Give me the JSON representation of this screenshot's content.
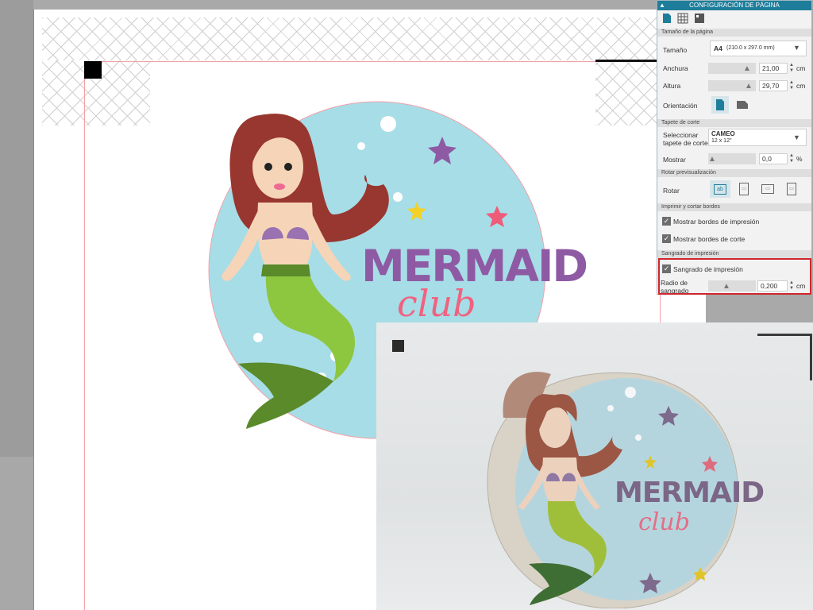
{
  "panel": {
    "title": "CONFIGURACIÓN DE PÁGINA",
    "collapse_icon": "caret-up",
    "tabs": [
      "page-icon",
      "grid-icon",
      "layer-icon"
    ],
    "page_size": {
      "section": "Tamaño de la página",
      "size_label": "Tamaño",
      "size_value": "A4",
      "size_detail": "(210.0 x 297.0 mm)",
      "width_label": "Anchura",
      "width_value": "21,00",
      "height_label": "Altura",
      "height_value": "29,70",
      "unit": "cm",
      "orientation_label": "Orientación"
    },
    "cutting_mat": {
      "section": "Tapete de corte",
      "select_label_1": "Seleccionar",
      "select_label_2": "tapete de corte",
      "mat_name": "CAMEO",
      "mat_size": "12 x 12\"",
      "show_label": "Mostrar",
      "show_value": "0,0",
      "show_unit": "%"
    },
    "rotate_preview": {
      "section": "Rotar previsualización",
      "rotate_label": "Rotar",
      "rotate_glyph": "ab"
    },
    "print_cut_borders": {
      "section": "Imprimir y cortar bordes",
      "show_print_borders": "Mostrar bordes de impresión",
      "show_cut_borders": "Mostrar bordes de corte"
    },
    "print_bleed": {
      "section": "Sangrado de impresión",
      "bleed_checkbox": "Sangrado de impresión",
      "radius_label_1": "Radio de",
      "radius_label_2": "sangrado",
      "radius_value": "0,200",
      "unit": "cm"
    }
  },
  "design": {
    "title_word": "MERMAID",
    "subtitle_word": "club"
  },
  "colors": {
    "panel_header": "#1e7d9a",
    "accent": "#1e7d9a",
    "highlight": "#d0262c",
    "circle": "#a7dde7",
    "title_purple": "#8e5aa3",
    "club_pink": "#f0627f",
    "hair": "#98372f",
    "skin": "#f6d4b8",
    "tail": "#8dc63f",
    "tail_dark": "#5a8a2a",
    "shell": "#9a72b1",
    "star_purple": "#8e5aa3",
    "star_yellow": "#f5d127",
    "star_pink": "#ef5c7a"
  }
}
